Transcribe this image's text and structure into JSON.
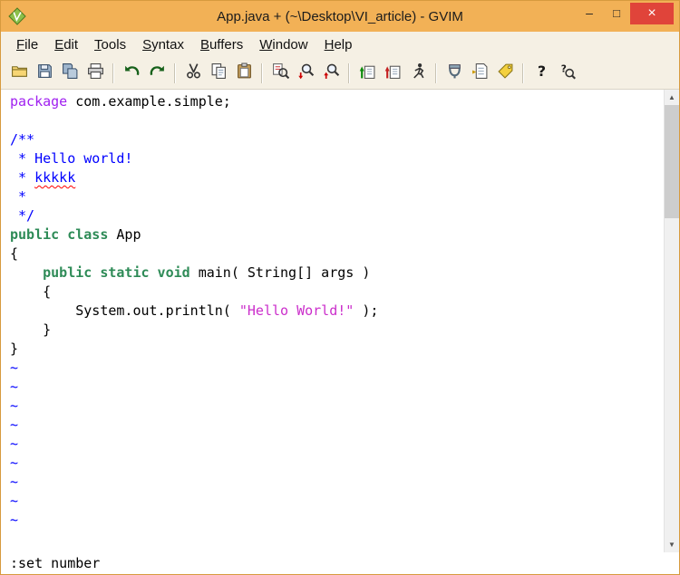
{
  "window": {
    "title": "App.java + (~\\Desktop\\VI_article) - GVIM",
    "controls": {
      "minimize": "–",
      "maximize": "□",
      "close": "×"
    }
  },
  "menubar": {
    "items": [
      {
        "label": "File"
      },
      {
        "label": "Edit"
      },
      {
        "label": "Tools"
      },
      {
        "label": "Syntax"
      },
      {
        "label": "Buffers"
      },
      {
        "label": "Window"
      },
      {
        "label": "Help"
      }
    ]
  },
  "toolbar": {
    "buttons": [
      {
        "name": "open"
      },
      {
        "name": "save"
      },
      {
        "name": "save-all"
      },
      {
        "name": "print"
      },
      {
        "type": "sep"
      },
      {
        "name": "undo"
      },
      {
        "name": "redo"
      },
      {
        "type": "sep"
      },
      {
        "name": "cut"
      },
      {
        "name": "copy"
      },
      {
        "name": "paste"
      },
      {
        "type": "sep"
      },
      {
        "name": "find-replace"
      },
      {
        "name": "find-next"
      },
      {
        "name": "find-prev"
      },
      {
        "type": "sep"
      },
      {
        "name": "load-session"
      },
      {
        "name": "save-session"
      },
      {
        "name": "run-script"
      },
      {
        "type": "sep"
      },
      {
        "name": "make"
      },
      {
        "name": "run-ctags"
      },
      {
        "name": "tag-jump"
      },
      {
        "type": "sep"
      },
      {
        "name": "help"
      },
      {
        "name": "find-help"
      }
    ]
  },
  "editor": {
    "lines": [
      {
        "segs": [
          {
            "t": "package",
            "c": "preproc"
          },
          {
            "t": " com.example.simple;",
            "c": "normal"
          }
        ]
      },
      {
        "segs": []
      },
      {
        "segs": [
          {
            "t": "/**",
            "c": "comment"
          }
        ]
      },
      {
        "segs": [
          {
            "t": " * Hello world!",
            "c": "comment"
          }
        ]
      },
      {
        "segs": [
          {
            "t": " * ",
            "c": "comment"
          },
          {
            "t": "kkkkk",
            "c": "comment",
            "spell": true
          }
        ]
      },
      {
        "segs": [
          {
            "t": " *",
            "c": "comment"
          }
        ]
      },
      {
        "segs": [
          {
            "t": " */",
            "c": "comment"
          }
        ]
      },
      {
        "segs": [
          {
            "t": "public class",
            "c": "statement"
          },
          {
            "t": " App",
            "c": "normal"
          }
        ]
      },
      {
        "segs": [
          {
            "t": "{",
            "c": "normal"
          }
        ]
      },
      {
        "segs": [
          {
            "t": "    ",
            "c": "normal"
          },
          {
            "t": "public static void",
            "c": "statement"
          },
          {
            "t": " main( String[] args )",
            "c": "normal"
          }
        ]
      },
      {
        "segs": [
          {
            "t": "    {",
            "c": "normal"
          }
        ]
      },
      {
        "segs": [
          {
            "t": "        System.out.println( ",
            "c": "normal"
          },
          {
            "t": "\"Hello World!\"",
            "c": "string"
          },
          {
            "t": " );",
            "c": "normal"
          }
        ]
      },
      {
        "segs": [
          {
            "t": "    }",
            "c": "normal"
          }
        ]
      },
      {
        "segs": [
          {
            "t": "}",
            "c": "normal"
          }
        ]
      }
    ],
    "filler": "~",
    "filler_count": 9,
    "command_line": ":set number"
  },
  "scrollbar": {
    "up": "▲",
    "down": "▼"
  },
  "colors": {
    "titlebar": "#f2b156",
    "chrome": "#f5f0e4",
    "close_button": "#e0443a",
    "comment": "#0000ff",
    "statement": "#2e8b57",
    "preproc": "#a020f0",
    "string": "#cb2ecb",
    "nontext": "#0000ff"
  }
}
